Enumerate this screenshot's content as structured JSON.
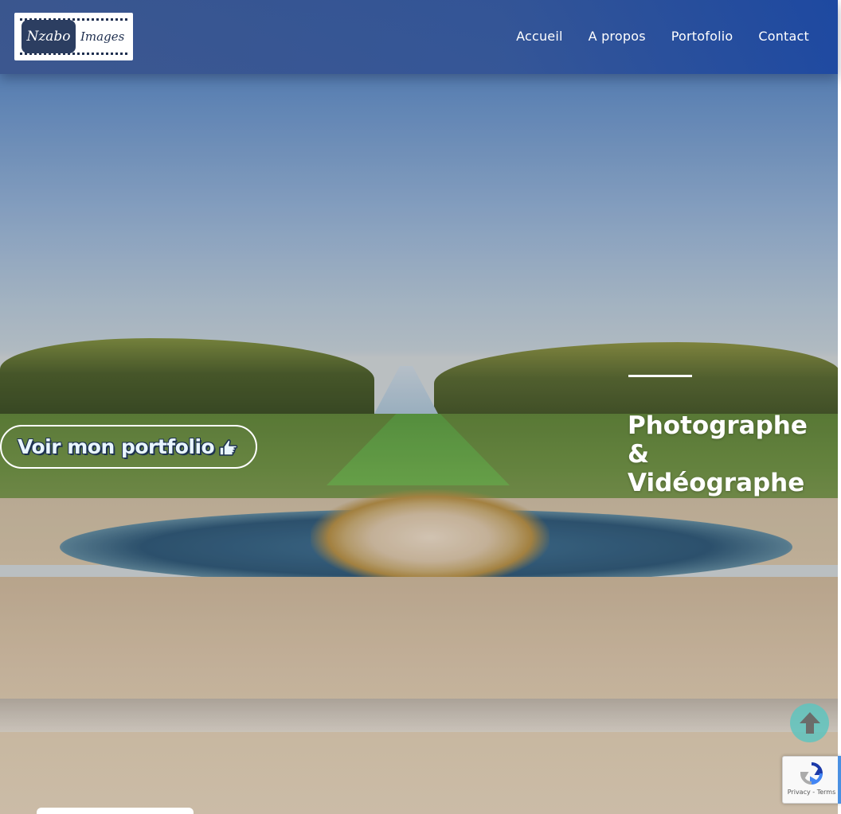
{
  "header": {
    "logo": {
      "badge_text": "Nzabo",
      "text": "Images"
    },
    "nav": [
      {
        "label": "Accueil"
      },
      {
        "label": "A propos"
      },
      {
        "label": "Portofolio"
      },
      {
        "label": "Contact"
      }
    ]
  },
  "hero": {
    "headline_line1": "Photographe &",
    "headline_line2": "Vidéographe",
    "cta_label": "Voir mon portfolio"
  },
  "recaptcha": {
    "terms_label": "Privacy - Terms"
  },
  "icons": {
    "cta": "hand-point-right-icon",
    "scroll_top": "arrow-up-circle-icon",
    "recaptcha": "recaptcha-logo-icon"
  },
  "colors": {
    "header_start": "#3a548c",
    "header_end": "#1b46a0",
    "scroll_top": "#5fc4be",
    "text": "#ffffff"
  }
}
